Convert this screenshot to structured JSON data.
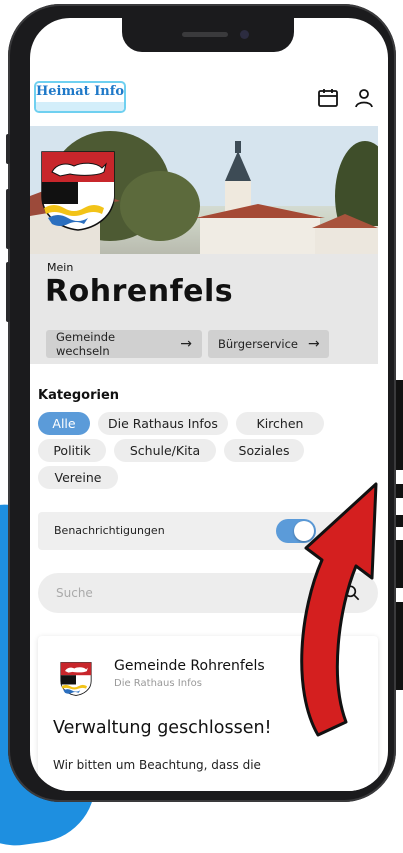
{
  "app": {
    "logo_text": "Heimat Info"
  },
  "header": {
    "calendar_icon": "calendar-icon",
    "profile_icon": "user-icon"
  },
  "hero": {
    "pre_title": "Mein",
    "city": "Rohrenfels"
  },
  "actions": {
    "switch_municipality": "Gemeinde wechseln",
    "citizen_service": "Bürgerservice",
    "arrow_glyph": "→"
  },
  "categories": {
    "title": "Kategorien",
    "chips": [
      "Alle",
      "Die Rathaus Infos",
      "Kirchen",
      "Politik",
      "Schule/Kita",
      "Soziales",
      "Vereine"
    ],
    "active": "Alle"
  },
  "notifications": {
    "label": "Benachrichtigungen",
    "enabled": true
  },
  "search": {
    "placeholder": "Suche"
  },
  "feed": [
    {
      "organization": "Gemeinde Rohrenfels",
      "category": "Die Rathaus Infos",
      "headline": "Verwaltung geschlossen!",
      "body": "Wir bitten um Beachtung, dass die"
    }
  ],
  "colors": {
    "accent": "#5b9bd9",
    "logo_blue": "#1f79c8",
    "annotation_arrow": "#d41f1f"
  }
}
